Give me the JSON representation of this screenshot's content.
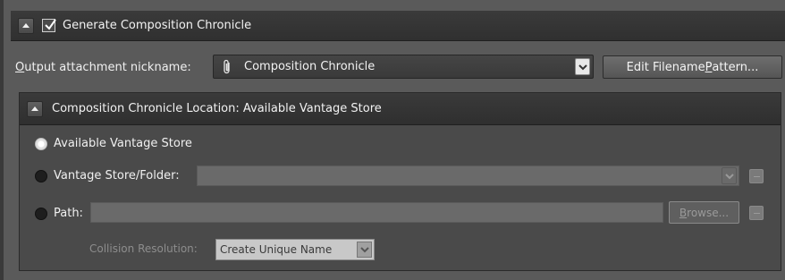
{
  "header": {
    "collapse_icon": "chevron-up-icon",
    "checkbox_checked": true,
    "title": "Generate Composition Chronicle"
  },
  "output": {
    "label_prefix": "O",
    "label_rest": "utput attachment nickname:",
    "nickname_value": "Composition Chronicle",
    "nickname_icon": "paperclip-icon",
    "edit_button_prefix": "Edit Filename ",
    "edit_button_underlined": "P",
    "edit_button_suffix": "attern..."
  },
  "location": {
    "title": "Composition Chronicle Location: Available Vantage Store",
    "options": [
      {
        "label": "Available Vantage Store",
        "selected": true
      },
      {
        "label": "Vantage Store/Folder:",
        "selected": false
      },
      {
        "label": "Path:",
        "selected": false
      }
    ],
    "browse_label_underlined": "B",
    "browse_label_rest": "rowse...",
    "collision_label": "Collision Resolution:",
    "collision_value": "Create Unique Name"
  },
  "colors": {
    "panel_bg": "#5a5a5a",
    "header_bg": "#333333",
    "disabled_field": "#6a6a6a"
  }
}
